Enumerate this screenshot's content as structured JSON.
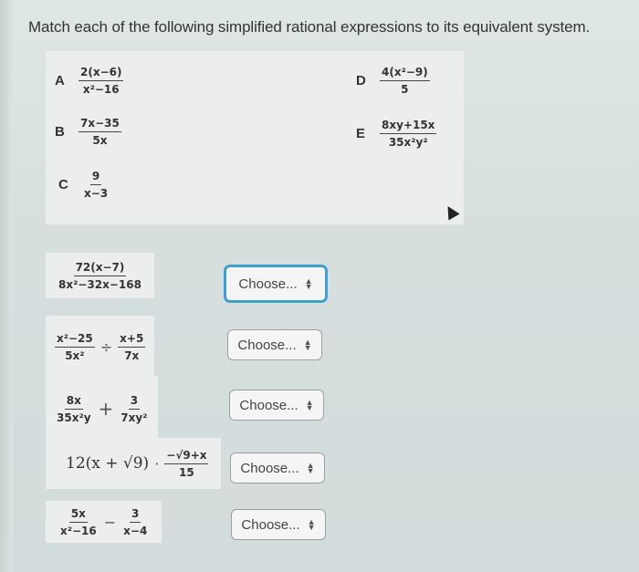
{
  "question": "Match each of the following simplified rational expressions to its equivalent system.",
  "options": [
    {
      "letter": "A",
      "num": "2(x−6)",
      "den": "x²−16"
    },
    {
      "letter": "B",
      "num": "7x−35",
      "den": "5x"
    },
    {
      "letter": "C",
      "num": "9",
      "den": "x−3"
    },
    {
      "letter": "D",
      "num": "4(x²−9)",
      "den": "5"
    },
    {
      "letter": "E",
      "num": "8xy+15x",
      "den": "35x²y²"
    }
  ],
  "problems": [
    {
      "type": "fraction",
      "num": "72(x−7)",
      "den": "8x²−32x−168",
      "select": "Choose..."
    },
    {
      "type": "binary",
      "left": {
        "num": "x²−25",
        "den": "5x²"
      },
      "operator": "÷",
      "right": {
        "num": "x+5",
        "den": "7x"
      },
      "select": "Choose..."
    },
    {
      "type": "binary",
      "left": {
        "num": "8x",
        "den": "35x²y"
      },
      "operator": "+",
      "right": {
        "num": "3",
        "den": "7xy²"
      },
      "select": "Choose..."
    },
    {
      "type": "product",
      "prefix": "12(x + √9)",
      "operator": "·",
      "right": {
        "num": "−√9+x",
        "den": "15"
      },
      "select": "Choose..."
    },
    {
      "type": "binary",
      "left": {
        "num": "5x",
        "den": "x²−16"
      },
      "operator": "−",
      "right": {
        "num": "3",
        "den": "x−4"
      },
      "select": "Choose..."
    }
  ],
  "select_arrows": {
    "up": "▲",
    "down": "▼"
  },
  "colors": {
    "focus": "#3f9fd1"
  }
}
